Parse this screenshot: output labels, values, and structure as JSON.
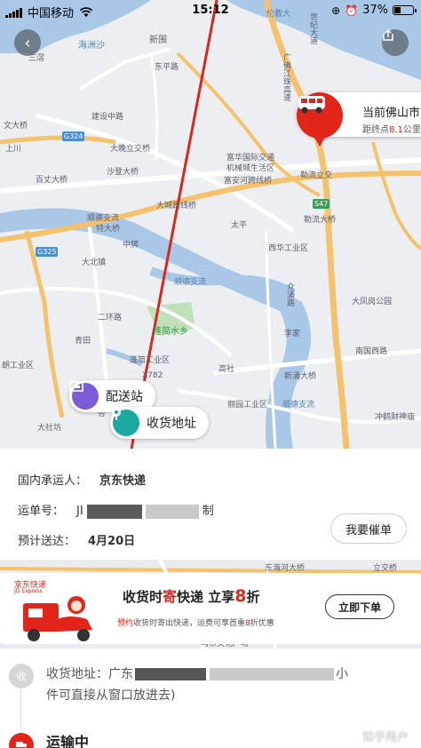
{
  "status_bar": {
    "carrier": "中国移动",
    "time": "15:12",
    "battery": "37%",
    "battery_level": 0.37
  },
  "map": {
    "labels": {
      "xinwei": "新围",
      "haizhousha": "海洲沙",
      "bozhouzhen": "伯洲镇",
      "shijidadao": "世纪大道",
      "dongpinglu": "东平路",
      "lunjiaoda": "伦教大",
      "guangfo": "广佛江珠高速",
      "shanda": "山大",
      "jianshezhonglu": "建设中路",
      "dazhanli": "大晚立交桥",
      "sanqi": "三滘",
      "shangchuan": "上川",
      "wentianqiao": "文大桥",
      "baiwenqiao": "百丈大桥",
      "shadengqiao": "沙登大桥",
      "fuhua": "富华国际交通",
      "jixie": "机械城生活区",
      "fuan": "富安河跨线桥",
      "fuanxiang": "富安跨线桥",
      "dachengyou": "大城跨线桥",
      "shundezhiliu": "顺德支流",
      "tedaqiao": "特大桥",
      "taiping": "太平",
      "qinliu": "勒流大桥",
      "xiaoze": "小湖",
      "xihua": "西华工业区",
      "dabeizhen": "大北镇",
      "zhongpai": "中牌",
      "shundezhiliu2": "顺德支流",
      "zhonglu": "众涌路",
      "dafenggang": "大凤岗公园",
      "penghushui": "蓬简水乡",
      "qingtian": "青田",
      "erhuanlu": "二环路",
      "lijia": "李家",
      "penghu_gongye": "蓬简工业区",
      "gaoshe": "高社",
      "nanguoxi": "南国西路",
      "xinyong": "新涌大桥",
      "youxiangqiao": "东海河大桥",
      "chonghe": "冲鹤财神庙",
      "dasheng": "大社坊",
      "langgong": "朗工业区",
      "shundezhiliu3": "顺德支流",
      "x782": "X782",
      "sang": "杏",
      "tangbu": "塘步",
      "liwei": "丽园工业区",
      "yongfu": "永富路",
      "g324": "G324",
      "g325": "G325",
      "s47": "S47",
      "s82": "S82",
      "qianli": "勒流立交"
    },
    "truck_card": {
      "title": "当前佛山市",
      "distance_prefix": "距终点",
      "distance_value": "8.1",
      "distance_unit": "公里"
    },
    "pills": {
      "station": "配送站",
      "receive": "收货地址"
    }
  },
  "shipment": {
    "carrier_label": "国内承运人：",
    "carrier_value": "京东快递",
    "waybill_label": "运单号：",
    "waybill_prefix": "JI",
    "waybill_suffix": "制",
    "eta_label": "预计送达：",
    "eta_value": "4月20日",
    "urge_button": "我要催单"
  },
  "ad": {
    "brand": "京东快递",
    "brand_sub": "JD Express",
    "title_part1": "收货时",
    "title_highlight": "寄",
    "title_part2": "快递 立享",
    "title_num": "8",
    "title_part3": "折",
    "sub_highlight": "预约",
    "sub_part1": "收货时寄出快递，运费可享首重",
    "sub_num": "8",
    "sub_part2": "折优惠",
    "button": "立即下单",
    "bg_labels": {
      "road1": "东海河大桥",
      "road2": "立交桥",
      "road3": "马东文化广场"
    }
  },
  "timeline": {
    "receive_badge": "收",
    "address_label": "收货地址：广东",
    "address_tail": "小",
    "address_line2": "件可直接从窗口放进去)",
    "status_text": "运输中",
    "watermark": "知乎用户"
  },
  "colors": {
    "accent_red": "#e1251b",
    "station_purple": "#7b5bd6",
    "receive_teal": "#1aa9a0",
    "route_red": "#d8281e"
  }
}
